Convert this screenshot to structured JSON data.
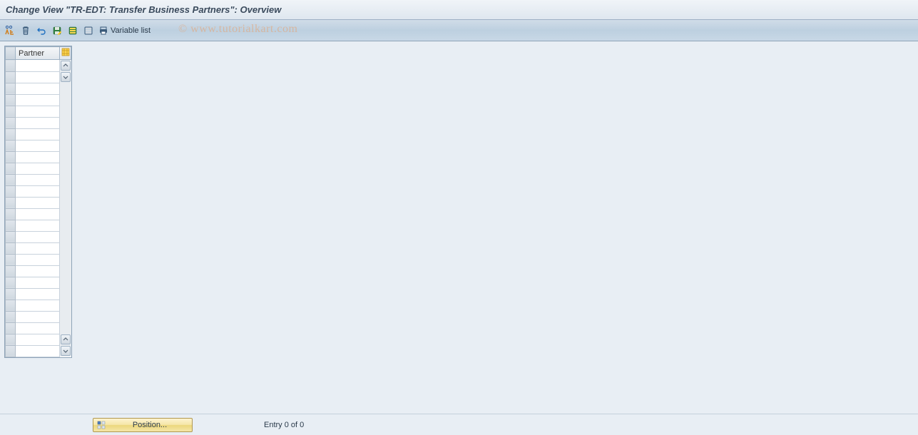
{
  "header": {
    "title": "Change View \"TR-EDT:  Transfer Business Partners\": Overview"
  },
  "toolbar": {
    "icons": {
      "toggle": "toggle-display-change",
      "delete": "delete",
      "undo": "undo",
      "save": "save",
      "select_all": "select-all",
      "deselect_all": "deselect-all",
      "print": "print"
    },
    "variable_list_label": "Variable list"
  },
  "watermark": "© www.tutorialkart.com",
  "grid": {
    "columns": [
      "Partner"
    ],
    "row_count": 26
  },
  "footer": {
    "position_label": "Position...",
    "status_text": "Entry 0 of 0"
  }
}
